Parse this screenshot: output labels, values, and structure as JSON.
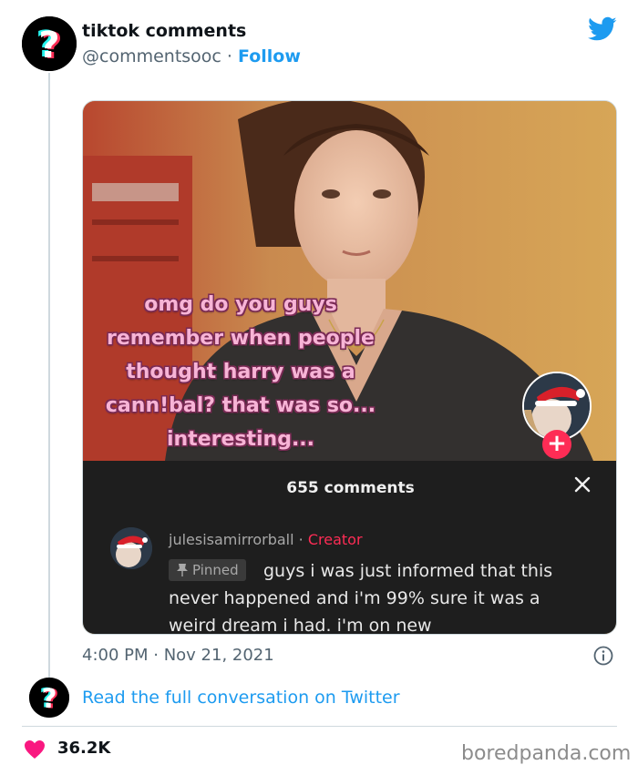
{
  "tweet": {
    "author_name": "tiktok comments",
    "author_handle": "@commentsooc",
    "separator": " · ",
    "follow_label": "Follow",
    "timestamp": "4:00 PM · Nov 21, 2021",
    "avatar_icon": "question-mark-icon",
    "brand_icon": "twitter-bird-icon",
    "accent_color": "#1d9bf0"
  },
  "media": {
    "caption_lines": [
      "omg do you guys",
      "remember when people",
      "thought harry was a",
      "cann!bal? that was so...",
      "interesting..."
    ],
    "plus_label": "+",
    "comments": {
      "count_label": "655 comments",
      "close_icon": "close-icon",
      "username": "julesisamirrorball",
      "creator_sep": " · ",
      "creator_label": "Creator",
      "pinned_label": "Pinned",
      "comment_text": "guys i was just informed that this never happened and i'm 99% sure it was a weird dream i had. i'm on new"
    }
  },
  "conversation": {
    "link_label": "Read the full conversation on Twitter"
  },
  "footer": {
    "like_count": "36.2K",
    "like_color": "#f91880",
    "watermark": "boredpanda.com"
  }
}
